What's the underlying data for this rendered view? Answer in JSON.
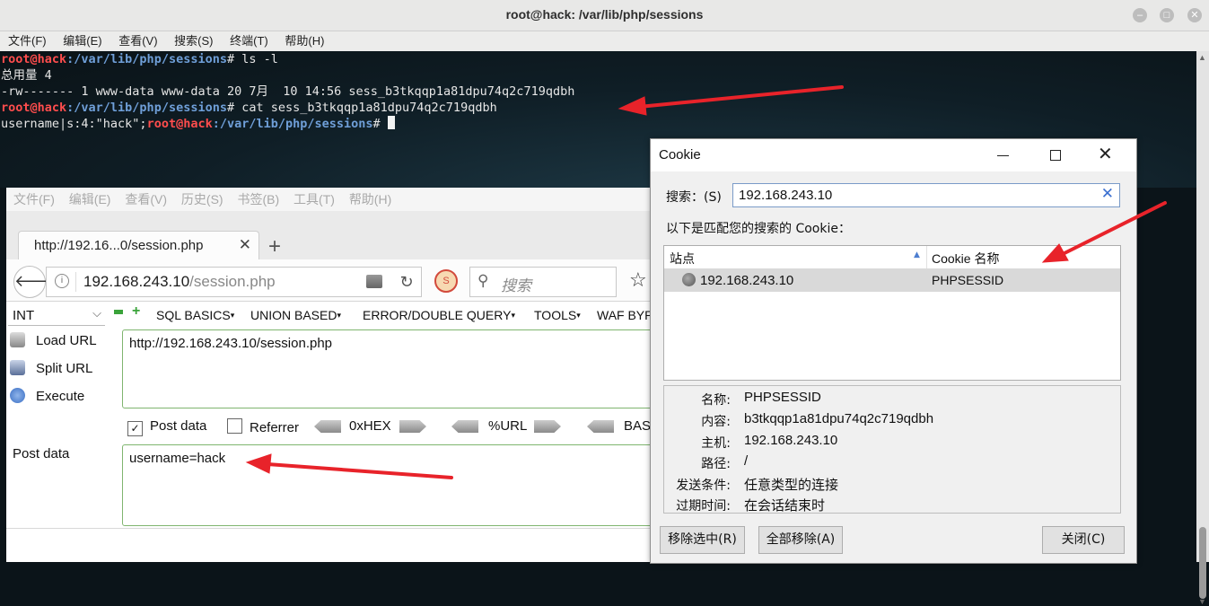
{
  "terminal": {
    "title": "root@hack: /var/lib/php/sessions",
    "menu": [
      "文件(F)",
      "编辑(E)",
      "查看(V)",
      "搜索(S)",
      "终端(T)",
      "帮助(H)"
    ],
    "prompt_user": "root@hack",
    "prompt_path": ":/var/lib/php/sessions",
    "prompt_end": "# ",
    "cmd1": "ls -l",
    "total": "总用量 4",
    "listing": "-rw------- 1 www-data www-data 20 7月  10 14:56 sess_b3tkqqp1a81dpu74q2c719qdbh",
    "cmd2": "cat sess_b3tkqqp1a81dpu74q2c719qdbh",
    "session_content": "username|s:4:\"hack\";"
  },
  "firefox": {
    "menu": [
      "文件(F)",
      "编辑(E)",
      "查看(V)",
      "历史(S)",
      "书签(B)",
      "工具(T)",
      "帮助(H)"
    ],
    "tab_label": "http://192.16...0/session.php",
    "url_host": "192.168.243.10",
    "url_path": "/session.php",
    "search_placeholder": "搜索",
    "hackbar": {
      "select_value": "INT",
      "menus": [
        "SQL BASICS",
        "UNION BASED",
        "ERROR/DOUBLE QUERY",
        "TOOLS",
        "WAF BYP"
      ],
      "load_url": "Load URL",
      "split_url": "Split URL",
      "execute": "Execute",
      "url_value": "http://192.168.243.10/session.php",
      "post_data_checkbox": "Post data",
      "post_data_checked": true,
      "referrer_checkbox": "Referrer",
      "referrer_checked": false,
      "hex": "0xHEX",
      "urlenc": "%URL",
      "base": "BAS",
      "post_label": "Post data",
      "post_value": "username=hack"
    }
  },
  "cookie_dialog": {
    "title": "Cookie",
    "search_label": "搜索：(S)",
    "search_value": "192.168.243.10",
    "match_label": "以下是匹配您的搜索的 Cookie：",
    "col_site": "站点",
    "col_name": "Cookie 名称",
    "row_site": "192.168.243.10",
    "row_name": "PHPSESSID",
    "details": [
      {
        "label": "名称:",
        "value": "PHPSESSID"
      },
      {
        "label": "内容:",
        "value": "b3tkqqp1a81dpu74q2c719qdbh"
      },
      {
        "label": "主机:",
        "value": "192.168.243.10"
      },
      {
        "label": "路径:",
        "value": "/"
      },
      {
        "label": "发送条件:",
        "value": "任意类型的连接"
      },
      {
        "label": "过期时间:",
        "value": "在会话结束时"
      }
    ],
    "btn_remove_selected": "移除选中(R)",
    "btn_remove_all": "全部移除(A)",
    "btn_close": "关闭(C)"
  },
  "colors": {
    "prompt_user": "#ff4d4d",
    "prompt_path": "#6f9fd8",
    "annotation_arrow": "#e8232a"
  }
}
